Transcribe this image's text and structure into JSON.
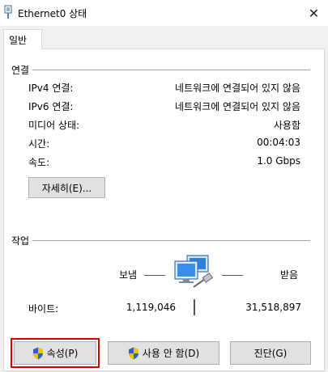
{
  "window": {
    "title": "Ethernet0 상태",
    "close_glyph": "✕"
  },
  "tabs": [
    {
      "label": "일반"
    }
  ],
  "connection": {
    "section_label": "연결",
    "rows": [
      {
        "label": "IPv4 연결:",
        "value": "네트워크에 연결되어 있지 않음"
      },
      {
        "label": "IPv6 연결:",
        "value": "네트워크에 연결되어 있지 않음"
      },
      {
        "label": "미디어 상태:",
        "value": "사용함"
      },
      {
        "label": "시간:",
        "value": "00:04:03"
      },
      {
        "label": "속도:",
        "value": "1.0 Gbps"
      }
    ],
    "details_button": "자세히(E)..."
  },
  "activity": {
    "section_label": "작업",
    "sent_label": "보냄",
    "received_label": "받음",
    "bytes_label": "바이트:",
    "bytes_sent": "1,119,046",
    "bytes_received": "31,518,897",
    "icon": "network-computers-icon"
  },
  "buttons": {
    "properties": "속성(P)",
    "disable": "사용 안 함(D)",
    "diagnose": "진단(G)"
  },
  "colors": {
    "highlight": "#d40000",
    "shield_blue": "#2b62c9",
    "shield_yellow": "#f4c20d"
  }
}
